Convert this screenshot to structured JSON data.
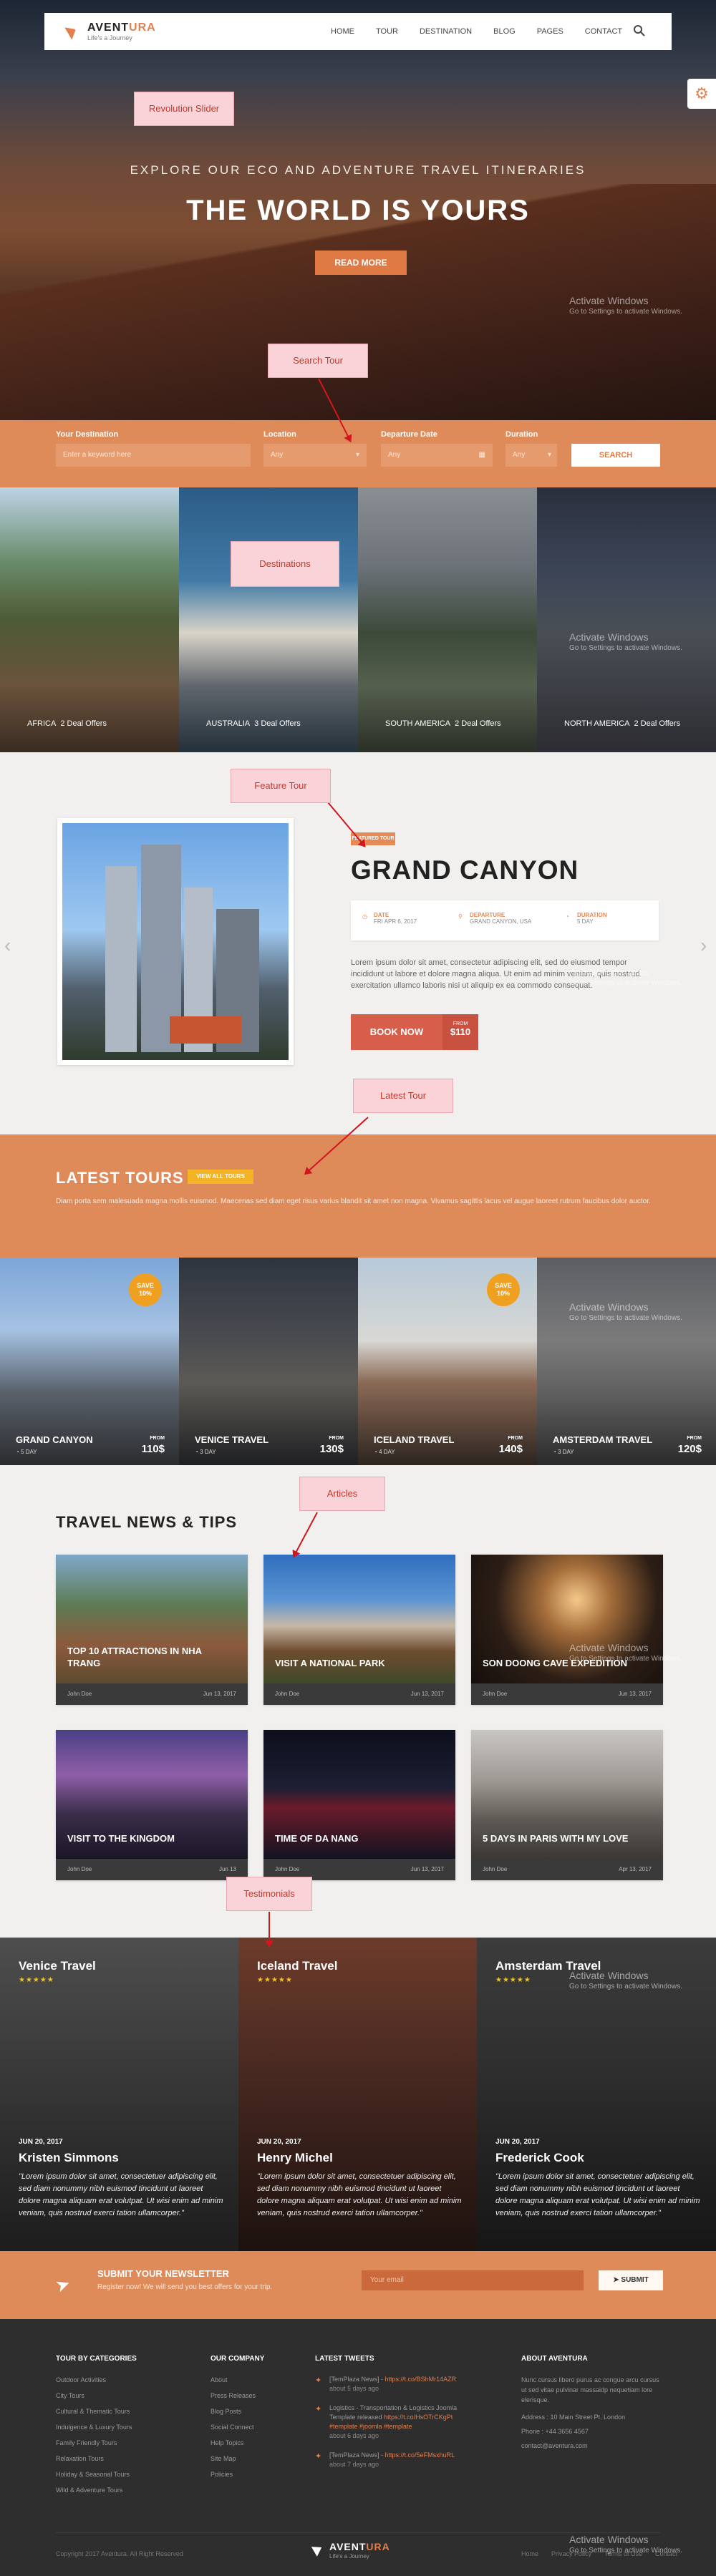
{
  "brand": {
    "name_a": "AVENT",
    "name_b": "URA",
    "tagline": "Life's a Journey"
  },
  "nav": {
    "items": [
      "HOME",
      "TOUR",
      "DESTINATION",
      "BLOG",
      "PAGES",
      "CONTACT"
    ]
  },
  "annotations": {
    "slider": "Revolution Slider",
    "search": "Search Tour",
    "destinations": "Destinations",
    "feature": "Feature Tour",
    "latest": "Latest Tour",
    "articles": "Articles",
    "testimonials": "Testimonials"
  },
  "windows_notice": {
    "title": "Activate Windows",
    "sub": "Go to Settings to activate Windows."
  },
  "hero": {
    "subtitle": "EXPLORE OUR ECO AND ADVENTURE TRAVEL ITINERARIES",
    "title": "THE WORLD IS YOURS",
    "button": "READ MORE"
  },
  "search": {
    "dest_label": "Your Destination",
    "dest_placeholder": "Enter a keyword here",
    "loc_label": "Location",
    "loc_value": "Any",
    "date_label": "Departure Date",
    "date_value": "Any",
    "dur_label": "Duration",
    "dur_value": "Any",
    "button": "SEARCH"
  },
  "destinations": [
    {
      "name": "AFRICA",
      "offers": "2 Deal Offers"
    },
    {
      "name": "AUSTRALIA",
      "offers": "3 Deal Offers"
    },
    {
      "name": "SOUTH AMERICA",
      "offers": "2 Deal Offers"
    },
    {
      "name": "NORTH AMERICA",
      "offers": "2 Deal Offers"
    }
  ],
  "featured": {
    "badge": "FEATURED TOUR",
    "title": "GRAND CANYON",
    "date_label": "DATE",
    "date_value": "FRI APR 6, 2017",
    "dep_label": "DEPARTURE",
    "dep_value": "GRAND CANYON, USA",
    "dur_label": "DURATION",
    "dur_value": "5 DAY",
    "description": "Lorem ipsum dolor sit amet, consectetur adipiscing elit, sed do eiusmod tempor incididunt ut labore et dolore magna aliqua. Ut enim ad minim veniam, quis nostrud exercitation ullamco laboris nisi ut aliquip ex ea commodo consequat.",
    "book": "BOOK NOW",
    "from": "FROM",
    "price": "$110"
  },
  "latest": {
    "title": "LATEST TOURS",
    "view_all": "VIEW ALL TOURS",
    "description": "Diam porta sem malesuada magna mollis euismod. Maecenas sed diam eget risus varius blandit sit amet non magna. Vivamus sagittis lacus vel augue laoreet rutrum faucibus dolor auctor.",
    "tours": [
      {
        "name": "GRAND CANYON",
        "days": "5 DAY",
        "from": "FROM",
        "price": "110$",
        "save": "SAVE",
        "save_pct": "10%"
      },
      {
        "name": "VENICE TRAVEL",
        "days": "3 DAY",
        "from": "FROM",
        "price": "130$",
        "save": "",
        "save_pct": ""
      },
      {
        "name": "ICELAND TRAVEL",
        "days": "4 DAY",
        "from": "FROM",
        "price": "140$",
        "save": "SAVE",
        "save_pct": "10%"
      },
      {
        "name": "AMSTERDAM TRAVEL",
        "days": "3 DAY",
        "from": "FROM",
        "price": "120$",
        "save": "",
        "save_pct": ""
      }
    ]
  },
  "news": {
    "title": "TRAVEL NEWS & TIPS",
    "articles": [
      {
        "title": "TOP 10 ATTRACTIONS IN NHA TRANG",
        "author": "John Doe",
        "date": "Jun 13, 2017"
      },
      {
        "title": "VISIT A NATIONAL PARK",
        "author": "John Doe",
        "date": "Jun 13, 2017"
      },
      {
        "title": "SON DOONG CAVE EXPEDITION",
        "author": "John Doe",
        "date": "Jun 13, 2017"
      },
      {
        "title": "VISIT TO THE KINGDOM",
        "author": "John Doe",
        "date": "Jun 13"
      },
      {
        "title": "TIME OF DA NANG",
        "author": "John Doe",
        "date": "Jun 13, 2017"
      },
      {
        "title": "5 DAYS IN PARIS WITH MY LOVE",
        "author": "John Doe",
        "date": "Apr 13, 2017"
      }
    ]
  },
  "testimonials": [
    {
      "location": "Venice Travel",
      "stars": "★★★★★",
      "date": "JUN 20, 2017",
      "name": "Kristen Simmons",
      "quote": "\"Lorem ipsum dolor sit amet, consectetuer adipiscing elit, sed diam nonummy nibh euismod tincidunt ut laoreet dolore magna aliquam erat volutpat. Ut wisi enim ad minim veniam, quis nostrud exerci tation ullamcorper.\""
    },
    {
      "location": "Iceland Travel",
      "stars": "★★★★★",
      "date": "JUN 20, 2017",
      "name": "Henry Michel",
      "quote": "\"Lorem ipsum dolor sit amet, consectetuer adipiscing elit, sed diam nonummy nibh euismod tincidunt ut laoreet dolore magna aliquam erat volutpat. Ut wisi enim ad minim veniam, quis nostrud exerci tation ullamcorper.\""
    },
    {
      "location": "Amsterdam Travel",
      "stars": "★★★★★",
      "date": "JUN 20, 2017",
      "name": "Frederick Cook",
      "quote": "\"Lorem ipsum dolor sit amet, consectetuer adipiscing elit, sed diam nonummy nibh euismod tincidunt ut laoreet dolore magna aliquam erat volutpat. Ut wisi enim ad minim veniam, quis nostrud exerci tation ullamcorper.\""
    }
  ],
  "newsletter": {
    "title": "SUBMIT YOUR NEWSLETTER",
    "description": "Register now! We will send you best offers for your trip.",
    "placeholder": "Your email",
    "button": "SUBMIT"
  },
  "footer": {
    "col1_title": "TOUR BY CATEGORIES",
    "col1": [
      "Outdoor Activities",
      "City Tours",
      "Cultural & Thematic Tours",
      "Indulgence & Luxury Tours",
      "Family Friendly Tours",
      "Relaxation Tours",
      "Holiday & Seasonal Tours",
      "Wild & Adventure Tours"
    ],
    "col2_title": "OUR COMPANY",
    "col2": [
      "About",
      "Press Releases",
      "Blog Posts",
      "Social Connect",
      "Help Topics",
      "Site Map",
      "Policies"
    ],
    "col3_title": "LATEST TWEETS",
    "tweets": [
      {
        "text": "[TemPlaza News] -",
        "link": "https://t.co/BShMr14AZR",
        "ago": "about 5 days ago"
      },
      {
        "text": "Logistics - Transportation & Logistics Joomla Template released",
        "link": "https://t.co/HsOTrCKgPt #template #joomla #template",
        "ago": "about 6 days ago"
      },
      {
        "text": "[TemPlaza News] -",
        "link": "https://t.co/5eFMsxhuRL",
        "ago": "about 7 days ago"
      }
    ],
    "col4_title": "ABOUT AVENTURA",
    "about": "Nunc cursus libero purus ac congue arcu cursus ut sed vitae pulvinar massaidp nequetiam lore elerisque.",
    "address": "Address : 10 Main Street Pt. London",
    "phone": "Phone : +44 3656 4567",
    "email": "contact@aventura.com",
    "copyright": "Copyright 2017 Aventura. All Right Reserved",
    "links": [
      "Home",
      "Privacy Policy",
      "Terms of Use",
      "Contact"
    ]
  }
}
